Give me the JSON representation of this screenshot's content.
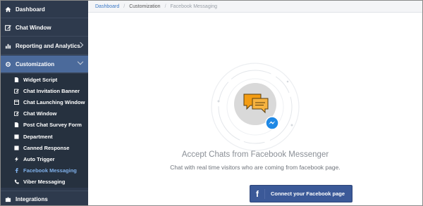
{
  "sidebar": {
    "items": [
      {
        "label": "Dashboard",
        "icon": "home-icon"
      },
      {
        "label": "Chat Window",
        "icon": "edit-icon"
      },
      {
        "label": "Reporting and Analytics",
        "icon": "chart-icon"
      },
      {
        "label": "Customization",
        "icon": "gear-icon"
      },
      {
        "label": "Integrations",
        "icon": "puzzle-icon"
      }
    ],
    "sub_items": [
      {
        "label": "Widget Script",
        "icon": "file-icon"
      },
      {
        "label": "Chat Invitation Banner",
        "icon": "edit-icon"
      },
      {
        "label": "Chat Launching Window",
        "icon": "window-icon"
      },
      {
        "label": "Chat Window",
        "icon": "edit-icon"
      },
      {
        "label": "Post Chat Survey Form",
        "icon": "file-icon"
      },
      {
        "label": "Department",
        "icon": "list-icon"
      },
      {
        "label": "Canned Response",
        "icon": "stop-icon"
      },
      {
        "label": "Auto Trigger",
        "icon": "bolt-icon"
      },
      {
        "label": "Facebook Messaging",
        "icon": "facebook-icon"
      },
      {
        "label": "Viber Messaging",
        "icon": "viber-icon"
      }
    ]
  },
  "breadcrumb": {
    "items": [
      "Dashboard",
      "Customization",
      "Facebook Messaging"
    ],
    "sep": "/"
  },
  "main": {
    "title": "Accept Chats from Facebook Messenger",
    "subtitle": "Chat with real time visitors who are coming from facebook page.",
    "button_icon": "f",
    "button_label": "Connect your Facebook page"
  },
  "colors": {
    "sidebar_bg": "#2e3a4d",
    "sidebar_active": "#4b6a9b",
    "link": "#3a78c7",
    "facebook": "#3b5998",
    "messenger": "#1e88e5",
    "chat_orange": "#f39c12"
  }
}
